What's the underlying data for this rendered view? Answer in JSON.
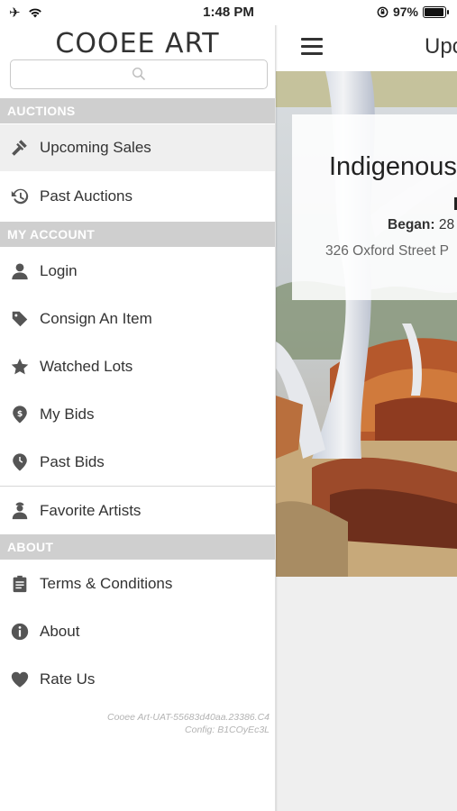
{
  "status": {
    "time": "1:48 PM",
    "battery": "97%",
    "battery_level": 0.97
  },
  "drawer": {
    "logo": "COOEE ART",
    "search": {
      "placeholder": ""
    },
    "sections": [
      {
        "label": "AUCTIONS"
      },
      {
        "label": "MY ACCOUNT"
      },
      {
        "label": "ABOUT"
      }
    ],
    "items": [
      {
        "label": "Upcoming Sales",
        "icon": "gavel-icon"
      },
      {
        "label": "Past Auctions",
        "icon": "history-icon"
      },
      {
        "label": "Login",
        "icon": "user-icon"
      },
      {
        "label": "Consign An Item",
        "icon": "tag-icon"
      },
      {
        "label": "Watched Lots",
        "icon": "star-icon"
      },
      {
        "label": "My Bids",
        "icon": "dollar-pin-icon"
      },
      {
        "label": "Past Bids",
        "icon": "clock-pin-icon"
      },
      {
        "label": "Favorite Artists",
        "icon": "artist-icon"
      },
      {
        "label": "Terms & Conditions",
        "icon": "clipboard-icon"
      },
      {
        "label": "About",
        "icon": "info-icon"
      },
      {
        "label": "Rate Us",
        "icon": "heart-icon"
      }
    ],
    "config_line1": "Cooee Art-UAT-55683d40aa.23386.C4",
    "config_line2": "Config: B1COyEc3L"
  },
  "main": {
    "nav_title": "Upc",
    "card": {
      "title": "Indigenous",
      "began_label": "Began:",
      "began_value": "28",
      "address": "326 Oxford Street P"
    }
  }
}
